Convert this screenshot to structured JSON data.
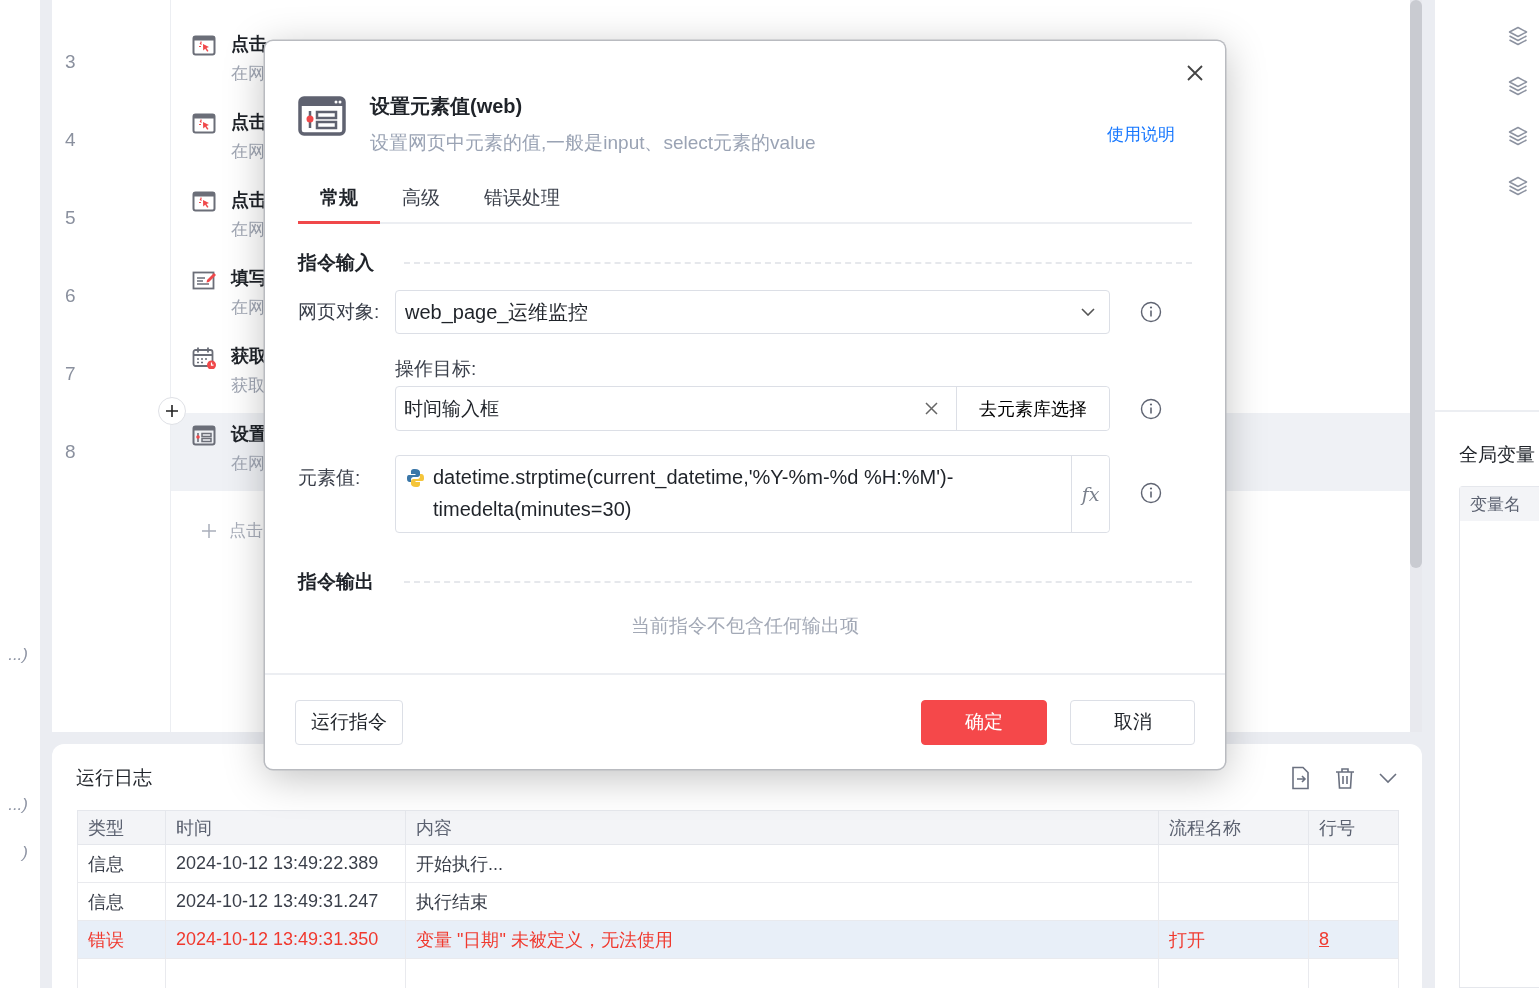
{
  "edge_fragments": [
    "...)",
    "...)",
    ")"
  ],
  "steps": [
    {
      "number": "3",
      "kind": "click",
      "title": "点击",
      "description": "在网",
      "selected": false
    },
    {
      "number": "4",
      "kind": "click",
      "title": "点击",
      "description": "在网",
      "selected": false
    },
    {
      "number": "5",
      "kind": "click",
      "title": "点击",
      "description": "在网",
      "selected": false
    },
    {
      "number": "6",
      "kind": "fill",
      "title": "填写",
      "description": "在网",
      "selected": false
    },
    {
      "number": "7",
      "kind": "calendar",
      "title": "获取",
      "description": "获取",
      "selected": false
    },
    {
      "number": "8",
      "kind": "set",
      "title": "设置",
      "description": "在网",
      "selected": true
    }
  ],
  "add_step": "点击",
  "side_panel": {
    "title": "全局变量",
    "column": "变量名"
  },
  "run_log": {
    "title": "运行日志",
    "columns": [
      "类型",
      "时间",
      "内容",
      "流程名称",
      "行号"
    ],
    "rows": [
      {
        "kind": "info",
        "selected": false,
        "cells": [
          "信息",
          "2024-10-12 13:49:22.389",
          "开始执行...",
          "",
          ""
        ]
      },
      {
        "kind": "info",
        "selected": false,
        "cells": [
          "信息",
          "2024-10-12 13:49:31.247",
          "执行结束",
          "",
          ""
        ]
      },
      {
        "kind": "error",
        "selected": true,
        "cells": [
          "错误",
          "2024-10-12 13:49:31.350",
          "变量 \"日期\" 未被定义，无法使用",
          "打开",
          "8"
        ]
      }
    ]
  },
  "dialog": {
    "title": "设置元素值(web)",
    "subtitle": "设置网页中元素的值,一般是input、select元素的value",
    "help_link": "使用说明",
    "tabs": [
      {
        "label": "常规",
        "selected": true
      },
      {
        "label": "高级",
        "selected": false
      },
      {
        "label": "错误处理",
        "selected": false
      }
    ],
    "input_section": "指令输入",
    "web_object": {
      "label": "网页对象:",
      "value": "web_page_运维监控"
    },
    "target": {
      "label": "操作目标:",
      "value": "时间输入框",
      "picker_button": "去元素库选择"
    },
    "element_value": {
      "label": "元素值:",
      "value": "datetime.strptime(current_datetime,'%Y-%m-%d %H:%M')-timedelta(minutes=30)",
      "fx_button": "fx"
    },
    "output_section": "指令输出",
    "output_empty": "当前指令不包含任何输出项",
    "buttons": {
      "run": "运行指令",
      "ok": "确定",
      "cancel": "取消"
    }
  }
}
